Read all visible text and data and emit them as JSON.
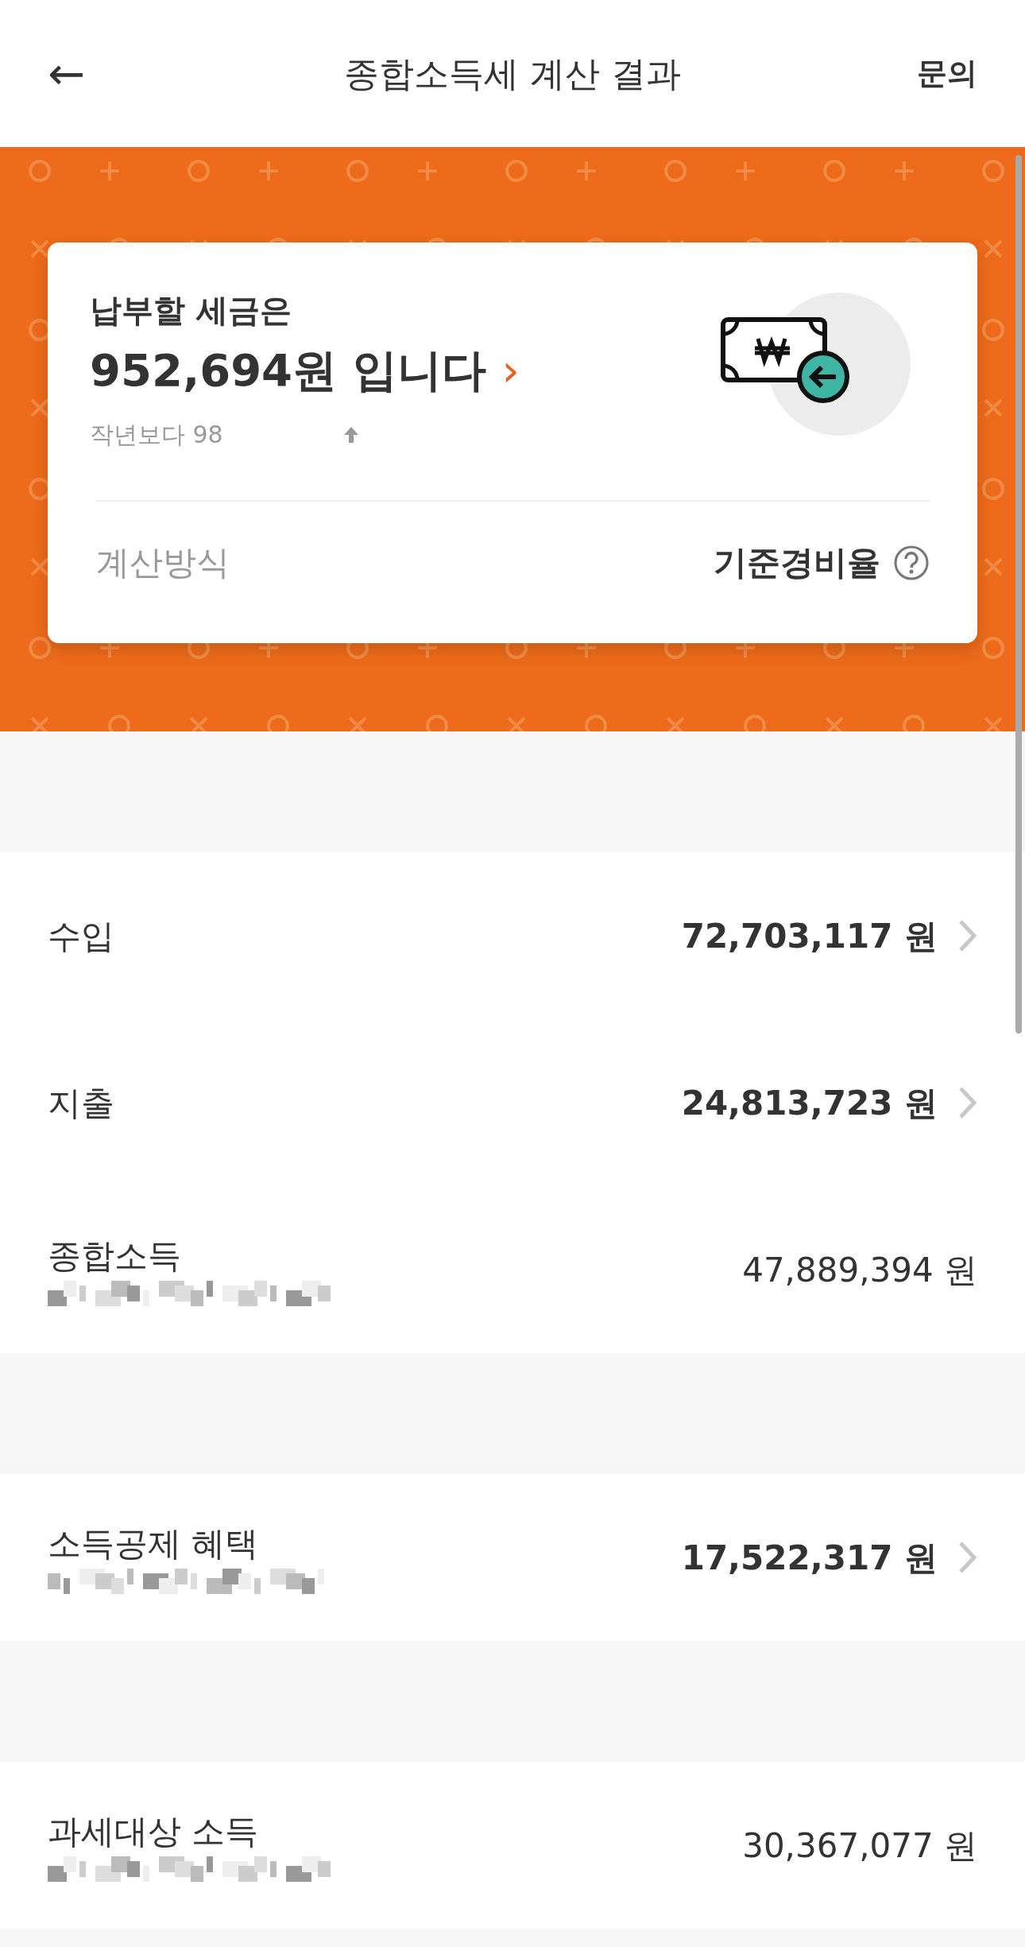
{
  "header": {
    "back": "←",
    "title": "종합소득세 계산 결과",
    "action": "문의"
  },
  "summary": {
    "label": "납부할 세금은",
    "amount": "952,694원 입니다",
    "chevron": "›",
    "comparison": "작년보다 98",
    "method_label": "계산방식",
    "method_value": "기준경비율"
  },
  "sections": [
    {
      "rows": [
        {
          "kind": "link",
          "label": "수입",
          "amount": "72,703,117 원",
          "redacted_subtitle": false
        },
        {
          "kind": "link",
          "label": "지출",
          "amount": "24,813,723 원",
          "redacted_subtitle": false
        },
        {
          "kind": "plain",
          "label": "종합소득",
          "amount": "47,889,394 원",
          "redacted_subtitle": true
        }
      ]
    },
    {
      "rows": [
        {
          "kind": "link",
          "label": "소득공제 혜택",
          "amount": "17,522,317 원",
          "redacted_subtitle": true
        }
      ]
    },
    {
      "rows": [
        {
          "kind": "plain",
          "label": "과세대상 소득",
          "amount": "30,367,077 원",
          "redacted_subtitle": true
        }
      ]
    }
  ]
}
